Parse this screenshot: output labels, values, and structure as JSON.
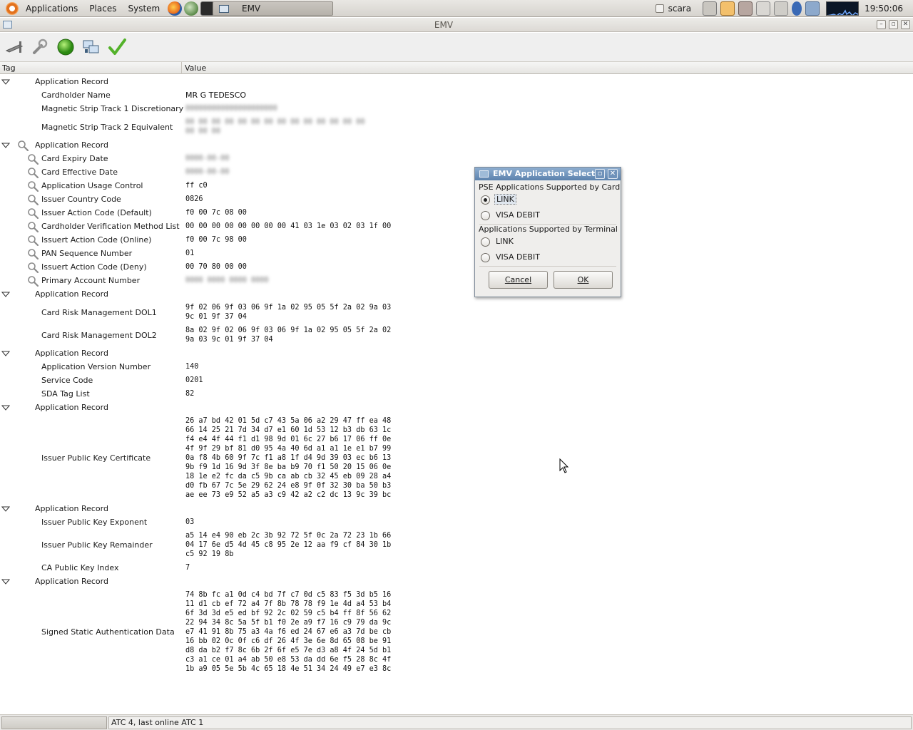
{
  "top_panel": {
    "menus": [
      "Applications",
      "Places",
      "System"
    ],
    "task_button": "EMV",
    "user": "scara",
    "clock": "19:50:06"
  },
  "window": {
    "title": "EMV"
  },
  "toolbar": {
    "icons": [
      "card-reader-icon",
      "tools-icon",
      "green-status-icon",
      "network-icon",
      "checkmark-icon"
    ]
  },
  "tree": {
    "col_tag": "Tag",
    "col_value": "Value",
    "rows": [
      {
        "kind": "record",
        "tag": "Application Record",
        "h": 19,
        "expander": true,
        "icon": false
      },
      {
        "kind": "item",
        "tag": "Cardholder Name",
        "value": "MR G TEDESCO",
        "h": 19,
        "mono": false,
        "icon": false
      },
      {
        "kind": "item",
        "tag": "Magnetic Strip Track 1 Discretionary",
        "value": "000000000000000000000",
        "h": 19,
        "blur": true,
        "icon": false
      },
      {
        "kind": "item",
        "tag": "Magnetic Strip Track 2 Equivalent",
        "value": "00 00 00 00 00 00 00 00 00 00 00 00 00 00\n00 00 00",
        "h": 32,
        "blur": true,
        "icon": false
      },
      {
        "kind": "record",
        "tag": "Application Record",
        "h": 19,
        "expander": true,
        "icon": true
      },
      {
        "kind": "item",
        "tag": "Card Expiry Date",
        "value": "0000-00-00",
        "h": 19,
        "blur": true,
        "icon": true
      },
      {
        "kind": "item",
        "tag": "Card Effective Date",
        "value": "0000-00-00",
        "h": 19,
        "blur": true,
        "icon": true
      },
      {
        "kind": "item",
        "tag": "Application Usage Control",
        "value": "ff c0",
        "h": 19,
        "icon": true
      },
      {
        "kind": "item",
        "tag": "Issuer Country Code",
        "value": "0826",
        "h": 19,
        "icon": true
      },
      {
        "kind": "item",
        "tag": "Issuer Action Code (Default)",
        "value": "f0 00 7c 08 00",
        "h": 19,
        "icon": true
      },
      {
        "kind": "item",
        "tag": "Cardholder Verification Method List",
        "value": "00 00 00 00 00 00 00 00 41 03 1e 03 02 03 1f 00",
        "h": 19,
        "icon": true
      },
      {
        "kind": "item",
        "tag": "Issuert Action Code (Online)",
        "value": "f0 00 7c 98 00",
        "h": 19,
        "icon": true
      },
      {
        "kind": "item",
        "tag": "PAN Sequence Number",
        "value": "01",
        "h": 19,
        "icon": true
      },
      {
        "kind": "item",
        "tag": "Issuert Action Code (Deny)",
        "value": "00 70 80 00 00",
        "h": 19,
        "icon": true
      },
      {
        "kind": "item",
        "tag": "Primary Account Number",
        "value": "0000 0000 0000 0000",
        "h": 19,
        "blur": true,
        "icon": true
      },
      {
        "kind": "record",
        "tag": "Application Record",
        "h": 19,
        "expander": true,
        "icon": false
      },
      {
        "kind": "item",
        "tag": "Card Risk Management DOL1",
        "value": "9f 02 06 9f 03 06 9f 1a 02 95 05 5f 2a 02 9a 03\n9c 01 9f 37 04",
        "h": 32,
        "icon": false
      },
      {
        "kind": "item",
        "tag": "Card Risk Management DOL2",
        "value": "8a 02 9f 02 06 9f 03 06 9f 1a 02 95 05 5f 2a 02\n9a 03 9c 01 9f 37 04",
        "h": 32,
        "icon": false
      },
      {
        "kind": "record",
        "tag": "Application Record",
        "h": 19,
        "expander": true,
        "icon": false
      },
      {
        "kind": "item",
        "tag": "Application Version Number",
        "value": "140",
        "h": 19,
        "icon": false
      },
      {
        "kind": "item",
        "tag": "Service Code",
        "value": "0201",
        "h": 19,
        "icon": false
      },
      {
        "kind": "item",
        "tag": "SDA Tag List",
        "value": "82",
        "h": 19,
        "icon": false
      },
      {
        "kind": "record",
        "tag": "Application Record",
        "h": 19,
        "expander": true,
        "icon": false
      },
      {
        "kind": "item",
        "tag": "Issuer Public Key Certificate",
        "value": "26 a7 bd 42 01 5d c7 43 5a 06 a2 29 47 ff ea 48\n66 14 25 21 7d 34 d7 e1 60 1d 53 12 b3 db 63 1c\nf4 e4 4f 44 f1 d1 98 9d 01 6c 27 b6 17 06 ff 0e\n4f 9f 29 bf 81 d0 95 4a 40 6d a1 a1 1e e1 b7 99\n0a f8 4b 60 9f 7c f1 a8 1f d4 9d 39 03 ec b6 13\n9b f9 1d 16 9d 3f 8e ba b9 70 f1 50 20 15 06 0e\n18 1e e2 fc da c5 9b ca ab cb 32 45 eb 09 28 a4\nd0 fb 67 7c 5e 29 62 24 e8 9f 0f 32 30 ba 50 b3\nae ee 73 e9 52 a5 a3 c9 42 a2 c2 dc 13 9c 39 bc",
        "h": 123,
        "icon": false
      },
      {
        "kind": "record",
        "tag": "Application Record",
        "h": 19,
        "expander": true,
        "icon": false
      },
      {
        "kind": "item",
        "tag": "Issuer Public Key Exponent",
        "value": "03",
        "h": 19,
        "icon": false
      },
      {
        "kind": "item",
        "tag": "Issuer Public Key Remainder",
        "value": "a5 14 e4 90 eb 2c 3b 92 72 5f 0c 2a 72 23 1b 66\n04 17 6e d5 4d 45 c8 95 2e 12 aa f9 cf 84 30 1b\nc5 92 19 8b",
        "h": 45,
        "icon": false
      },
      {
        "kind": "item",
        "tag": "CA Public Key Index",
        "value": "7",
        "h": 19,
        "icon": false
      },
      {
        "kind": "record",
        "tag": "Application Record",
        "h": 19,
        "expander": true,
        "icon": false
      },
      {
        "kind": "item",
        "tag": "Signed Static Authentication Data",
        "value": "74 8b fc a1 0d c4 bd 7f c7 0d c5 83 f5 3d b5 16\n11 d1 cb ef 72 a4 7f 8b 78 78 f9 1e 4d a4 53 b4\n6f 3d 3d e5 ed bf 92 2c 02 59 c5 b4 ff 8f 56 62\n22 94 34 8c 5a 5f b1 f0 2e a9 f7 16 c9 79 da 9c\ne7 41 91 8b 75 a3 4a f6 ed 24 67 e6 a3 7d be cb\n16 bb 02 0c 0f c6 df 26 4f 3e 6e 8d 65 08 be 91\nd8 da b2 f7 8c 6b 2f 6f e5 7e d3 a8 4f 24 5d b1\nc3 a1 ce 01 a4 ab 50 e8 53 da dd 6e f5 28 8c 4f\n1b a9 05 5e 5b 4c 65 18 4e 51 34 24 49 e7 e3 8c",
        "h": 123,
        "icon": false
      }
    ]
  },
  "status": {
    "text": "ATC 4, last online ATC 1"
  },
  "dialog": {
    "title": "EMV Application Select",
    "card_section": "PSE Applications Supported by Card",
    "card_options": [
      {
        "label": "LINK",
        "checked": true
      },
      {
        "label": "VISA DEBIT",
        "checked": false
      }
    ],
    "terminal_section": "Applications Supported by Terminal",
    "terminal_options": [
      {
        "label": "LINK",
        "checked": false
      },
      {
        "label": "VISA DEBIT",
        "checked": false
      }
    ],
    "cancel_label": "Cancel",
    "ok_label": "OK"
  }
}
